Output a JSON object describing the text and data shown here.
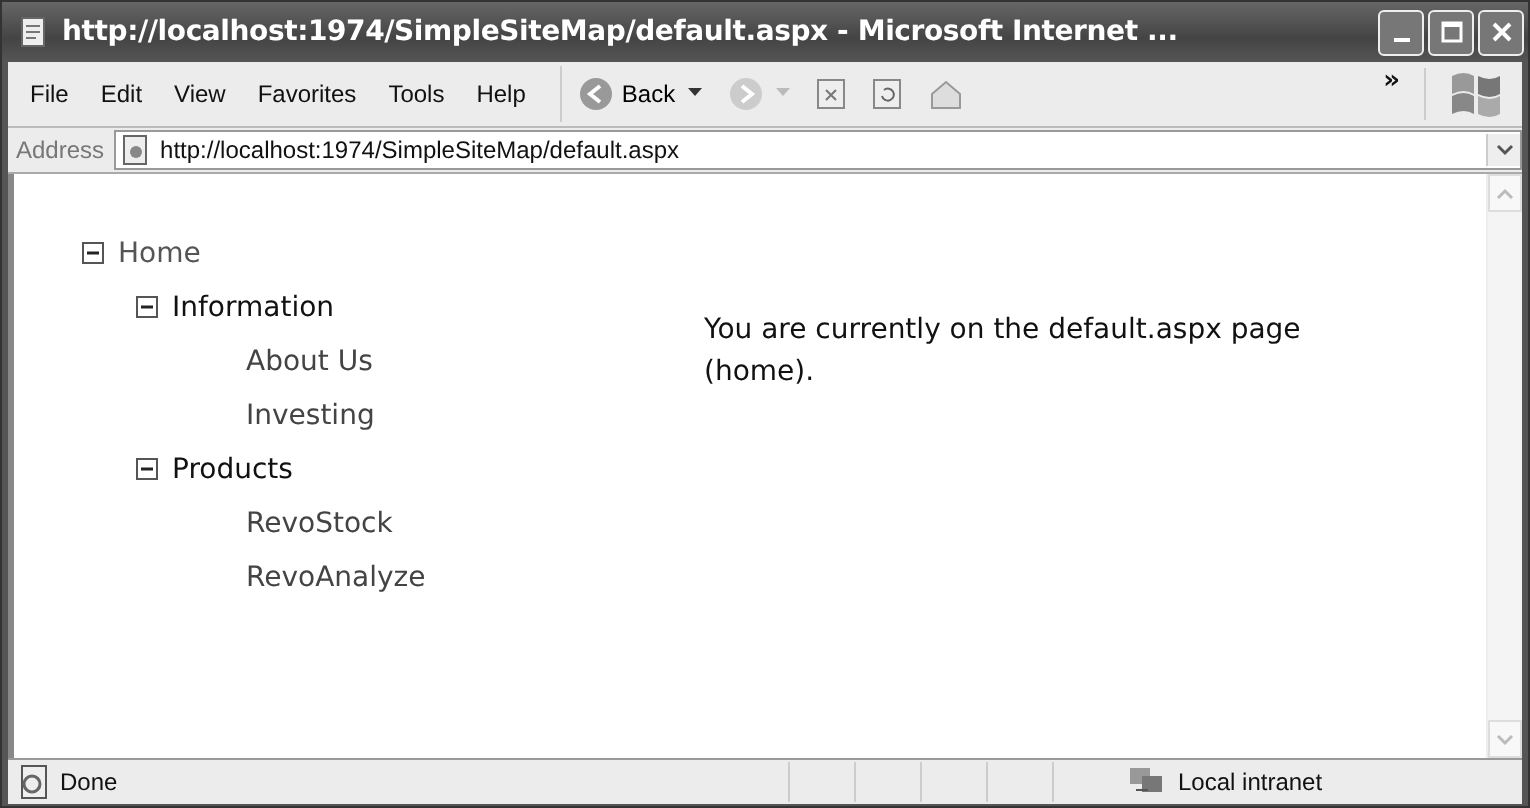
{
  "window": {
    "title": "http://localhost:1974/SimpleSiteMap/default.aspx - Microsoft Internet ..."
  },
  "menu": [
    "File",
    "Edit",
    "View",
    "Favorites",
    "Tools",
    "Help"
  ],
  "toolbar": {
    "back_label": "Back",
    "chevron": "»"
  },
  "address": {
    "label": "Address",
    "value": "http://localhost:1974/SimpleSiteMap/default.aspx"
  },
  "tree": [
    {
      "label": "Home",
      "expanded": true,
      "children": [
        {
          "label": "Information",
          "expanded": true,
          "children": [
            {
              "label": "About Us"
            },
            {
              "label": "Investing"
            }
          ]
        },
        {
          "label": "Products",
          "expanded": true,
          "children": [
            {
              "label": "RevoStock"
            },
            {
              "label": "RevoAnalyze"
            }
          ]
        }
      ]
    }
  ],
  "message": "You are currently on the default.aspx page (home).",
  "status_bar": {
    "status": "Done",
    "zone": "Local intranet"
  }
}
